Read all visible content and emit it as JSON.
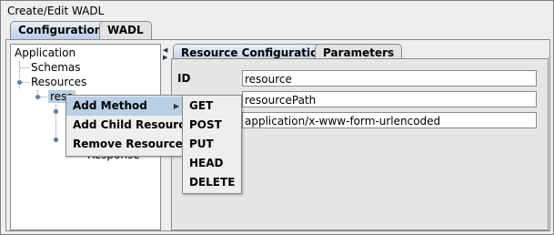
{
  "window": {
    "title": "Create/Edit WADL"
  },
  "tabs": [
    {
      "label": "Configuration"
    },
    {
      "label": "WADL"
    }
  ],
  "tree": {
    "items": [
      {
        "label": "Application"
      },
      {
        "label": "Schemas"
      },
      {
        "label": "Resources"
      },
      {
        "label": "reso"
      },
      {
        "label": "Response"
      }
    ]
  },
  "inner_tabs": [
    {
      "label": "Resource Configuration"
    },
    {
      "label": "Parameters"
    }
  ],
  "form": {
    "id_label": "ID",
    "id_value": "resource",
    "path_value": "resourcePath",
    "media_value": "application/x-www-form-urlencoded"
  },
  "context_menu": {
    "items": [
      {
        "label": "Add Method"
      },
      {
        "label": "Add Child Resource"
      },
      {
        "label": "Remove  Resource"
      }
    ]
  },
  "submenu": {
    "items": [
      {
        "label": "GET"
      },
      {
        "label": "POST"
      },
      {
        "label": "PUT"
      },
      {
        "label": "HEAD"
      },
      {
        "label": "DELETE"
      }
    ]
  },
  "colors": {
    "highlight": "#b8cfe5",
    "tab_active": "#b9cde6",
    "node_dot": "#5a7aa0"
  }
}
